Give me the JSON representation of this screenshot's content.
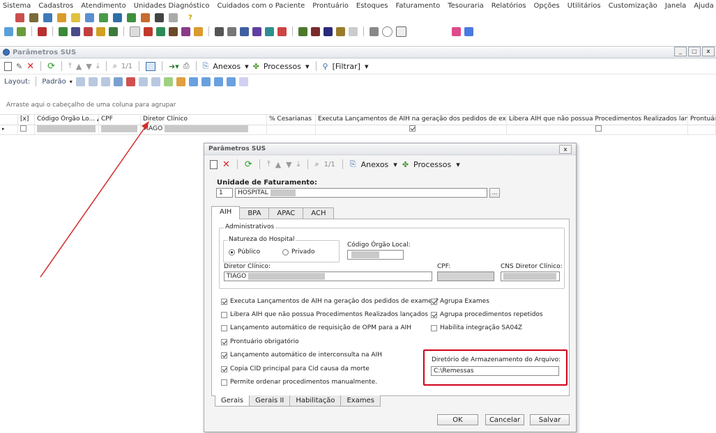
{
  "menu": [
    "Sistema",
    "Cadastros",
    "Atendimento",
    "Unidades Diagnóstico",
    "Cuidados com o Paciente",
    "Prontuário",
    "Estoques",
    "Faturamento",
    "Tesouraria",
    "Relatórios",
    "Opções",
    "Utilitários",
    "Customização",
    "Janela",
    "Ajuda"
  ],
  "window": {
    "title": "Parâmetros SUS"
  },
  "toolbar": {
    "page": "1/1",
    "anexos": "Anexos",
    "processos": "Processos",
    "filtrar": "[Filtrar]"
  },
  "layout_bar": {
    "layout_label": "Layout:",
    "padrao": "Padrão"
  },
  "grid": {
    "group_hint": "Arraste aqui o cabeçalho de uma coluna para agrupar",
    "columns": [
      "[x]",
      "Código Órgão Lo...",
      "CPF",
      "Diretor Clínico",
      "% Cesarianas",
      "Executa Lançamentos de AIH na geração dos pedidos de exames?",
      "Libera AIH que não possua Procedimentos Realizados lançados",
      "Prontuári"
    ],
    "row": {
      "diretor": "TIAGO",
      "executa_checked": true,
      "libera_checked": false
    }
  },
  "dialog": {
    "title": "Parâmetros SUS",
    "close": "x",
    "page": "1/1",
    "anexos": "Anexos",
    "processos": "Processos",
    "unidade_label": "Unidade de Faturamento:",
    "unidade_code": "1",
    "unidade_name": "HOSPITAL",
    "tabs": [
      "AIH",
      "BPA",
      "APAC",
      "ACH"
    ],
    "active_tab": "AIH",
    "administrativos": "Administrativos",
    "natureza": "Natureza do Hospital",
    "publico": "Público",
    "privado": "Privado",
    "codigo_orgao": "Código Órgão Local:",
    "diretor_label": "Diretor Clínico:",
    "diretor_value": "TIAGO",
    "cpf_label": "CPF:",
    "cns_label": "CNS Diretor Clínico:",
    "checks_left": [
      {
        "label": "Executa Lançamentos de AIH na geração dos pedidos de exames?",
        "checked": true
      },
      {
        "label": "Libera AIH que não possua Procedimentos Realizados lançados",
        "checked": false
      },
      {
        "label": "Lançamento automático de requisição de OPM para a AIH",
        "checked": false
      },
      {
        "label": "Prontuário obrigatório",
        "checked": true
      },
      {
        "label": "Lançamento automático de interconsulta na AIH",
        "checked": true
      },
      {
        "label": "Copia CID principal para Cid causa da morte",
        "checked": true
      },
      {
        "label": "Permite ordenar procedimentos manualmente.",
        "checked": false
      }
    ],
    "checks_right": [
      {
        "label": "Agrupa Exames",
        "checked": true
      },
      {
        "label": "Agrupa procedimentos repetidos",
        "checked": true
      },
      {
        "label": "Habilita integração SA04Z",
        "checked": false
      }
    ],
    "diretorio_label": "Diretório de Armazenamento do Arquivo:",
    "diretorio_value": "C:\\Remessas",
    "bottom_tabs": [
      "Gerais",
      "Gerais II",
      "Habilitação",
      "Exames"
    ],
    "ok": "OK",
    "cancelar": "Cancelar",
    "salvar": "Salvar"
  },
  "colors": {
    "highlight": "#d0021b",
    "arrow": "#d22b2b"
  }
}
